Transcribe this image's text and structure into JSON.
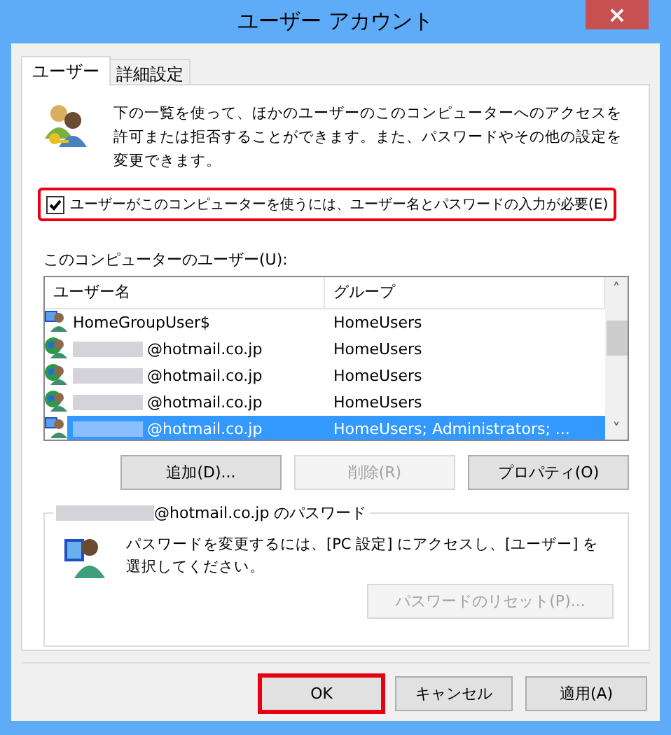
{
  "window": {
    "title": "ユーザー アカウント",
    "close": "×"
  },
  "tabs": [
    {
      "label": "ユーザー",
      "selected": true
    },
    {
      "label": "詳細設定",
      "selected": false
    }
  ],
  "description": "下の一覧を使って、ほかのユーザーのこのコンピューターへのアクセスを許可または拒否することができます。また、パスワードやその他の設定を変更できます。",
  "require_login": {
    "label": "ユーザーがこのコンピューターを使うには、ユーザー名とパスワードの入力が必要(E)",
    "checked": true,
    "highlighted": true
  },
  "users": {
    "label": "このコンピューターのユーザー(U):",
    "columns": [
      "ユーザー名",
      "グループ"
    ],
    "rows": [
      {
        "kind": "local",
        "redacted": false,
        "name": "HomeGroupUser$",
        "group": "HomeUsers",
        "selected": false
      },
      {
        "kind": "online",
        "redacted": true,
        "name": "@hotmail.co.jp",
        "group": "HomeUsers",
        "selected": false
      },
      {
        "kind": "online",
        "redacted": true,
        "name": "@hotmail.co.jp",
        "group": "HomeUsers",
        "selected": false
      },
      {
        "kind": "online",
        "redacted": true,
        "name": "@hotmail.co.jp",
        "group": "HomeUsers",
        "selected": false
      },
      {
        "kind": "local",
        "redacted": true,
        "name": "@hotmail.co.jp",
        "group": "HomeUsers; Administrators; ...",
        "selected": true
      }
    ],
    "scroll_up": "˄",
    "scroll_down": "˅"
  },
  "user_buttons": [
    {
      "label": "追加(D)...",
      "disabled": false
    },
    {
      "label": "削除(R)",
      "disabled": true
    },
    {
      "label": "プロパティ(O)",
      "disabled": false
    }
  ],
  "password": {
    "title": "@hotmail.co.jp のパスワード",
    "title_redacted": true,
    "text": "パスワードを変更するには、[PC 設定] にアクセスし、[ユーザー] を選択してください。",
    "reset": {
      "label": "パスワードのリセット(P)...",
      "disabled": true
    }
  },
  "dialog_buttons": [
    {
      "label": "OK",
      "highlighted": true,
      "disabled": false
    },
    {
      "label": "キャンセル",
      "highlighted": false,
      "disabled": false
    },
    {
      "label": "適用(A)",
      "highlighted": false,
      "disabled": false
    }
  ]
}
